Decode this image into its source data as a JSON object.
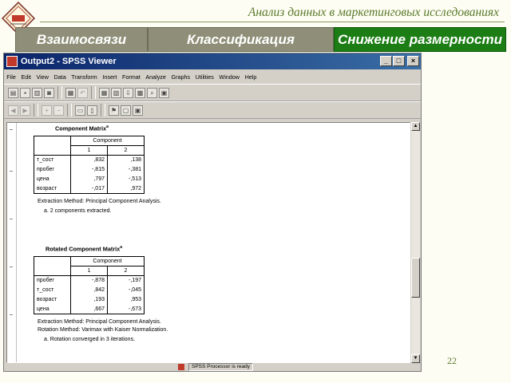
{
  "slide": {
    "title": "Анализ данных в маркетинговых исследованиях",
    "page_number": "22",
    "nav": [
      "Взаимосвязи",
      "Классификация",
      "Снижение размерности"
    ],
    "nav_active_color": "#1c7d15",
    "nav_inactive_color": "#8f8f79"
  },
  "window": {
    "title": "Output2 - SPSS Viewer",
    "buttons": [
      "minimize",
      "maximize",
      "close"
    ],
    "menu": [
      "File",
      "Edit",
      "View",
      "Data",
      "Transform",
      "Insert",
      "Format",
      "Analyze",
      "Graphs",
      "Utilities",
      "Window",
      "Help"
    ],
    "toolbar1": [
      "open-icon",
      "save-icon",
      "print-icon",
      "print-preview-icon",
      "export-icon",
      "undo-icon",
      "goto-data-icon",
      "recall-dialog-icon",
      "goto-case-icon",
      "variables-icon",
      "find-icon",
      "insert-cases-icon"
    ],
    "toolbar2": [
      "back-icon",
      "forward-icon",
      "promote-icon",
      "demote-icon",
      "expand-icon",
      "collapse-icon",
      "show-icon",
      "hide-icon",
      "designate-window-icon"
    ],
    "status": "SPSS Processor  is ready"
  },
  "tables": [
    {
      "title": "Component Matrix",
      "superscript": "a",
      "header": "Component",
      "columns": [
        "1",
        "2"
      ],
      "rows": [
        {
          "label": "т_сост",
          "values": [
            ",832",
            ",138"
          ]
        },
        {
          "label": "пробег",
          "values": [
            "-,815",
            "-,381"
          ]
        },
        {
          "label": "цена",
          "values": [
            ",797",
            "-,513"
          ]
        },
        {
          "label": "возраст",
          "values": [
            "-,017",
            ",972"
          ]
        }
      ],
      "footnotes": [
        "Extraction Method: Principal Component Analysis.",
        "a. 2 components extracted."
      ]
    },
    {
      "title": "Rotated Component Matrix",
      "superscript": "a",
      "header": "Component",
      "columns": [
        "1",
        "2"
      ],
      "rows": [
        {
          "label": "пробег",
          "values": [
            "-,878",
            "-,197"
          ]
        },
        {
          "label": "т_сост",
          "values": [
            ",842",
            "-,045"
          ]
        },
        {
          "label": "возраст",
          "values": [
            ",193",
            ",953"
          ]
        },
        {
          "label": "цена",
          "values": [
            ",667",
            "-,673"
          ]
        }
      ],
      "footnotes": [
        "Extraction Method: Principal Component Analysis.",
        "Rotation Method: Varimax with Kaiser Normalization.",
        "a. Rotation converged in 3 iterations."
      ]
    }
  ]
}
